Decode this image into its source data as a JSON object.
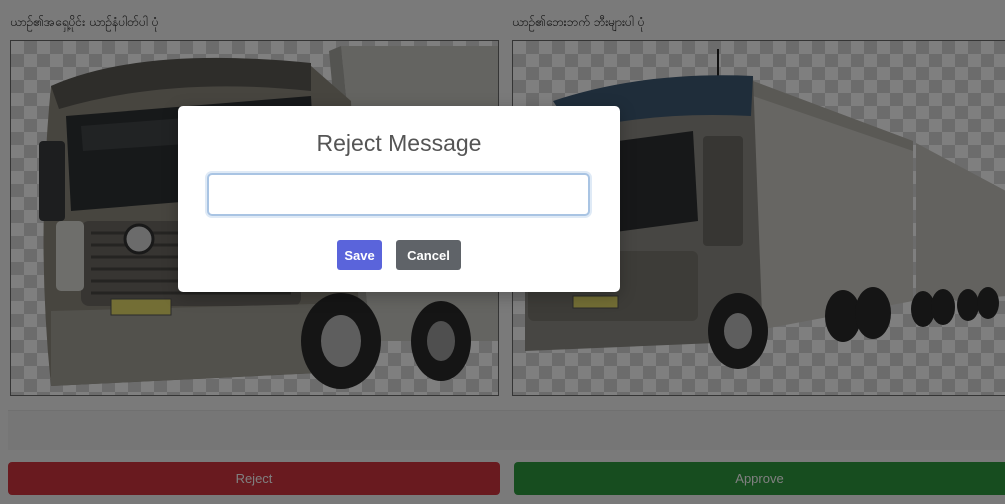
{
  "photos": {
    "front_label": "ယာဉ်၏အရှေ့ပိုင်း ယာဉ်နံပါတ်ပါ ပုံ",
    "side_label": "ယာဉ်၏ဘေးဘက် ဘီးများပါ ပုံ",
    "front_image": "truck-front-photo",
    "side_image": "truck-side-photo"
  },
  "actions": {
    "reject_label": "Reject",
    "approve_label": "Approve"
  },
  "modal": {
    "title": "Reject Message",
    "input_value": "",
    "input_placeholder": "",
    "save_label": "Save",
    "cancel_label": "Cancel"
  },
  "colors": {
    "reject": "#d2343e",
    "approve": "#2f9a3f",
    "save": "#5a64db",
    "cancel": "#5f6368"
  }
}
